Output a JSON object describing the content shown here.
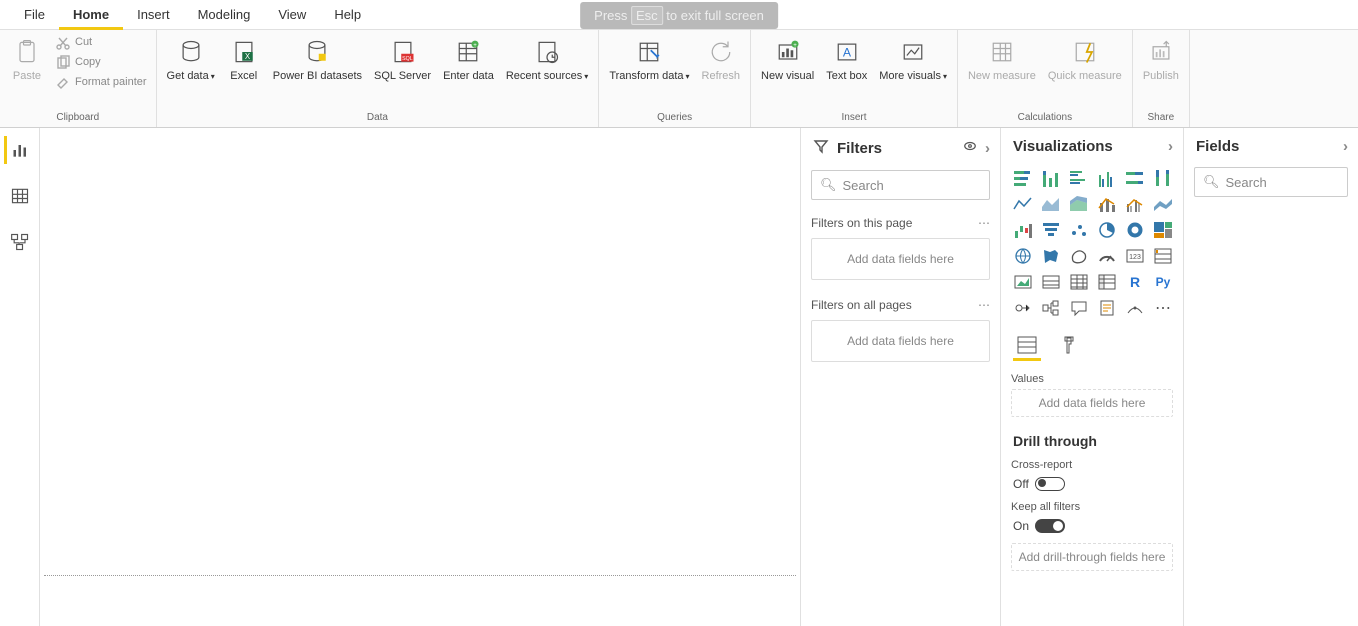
{
  "overlay": {
    "full_text": "Press Esc to exit full screen",
    "press": "Press",
    "esc": "Esc",
    "rest": "to exit full screen"
  },
  "tabs": {
    "file": "File",
    "home": "Home",
    "insert": "Insert",
    "modeling": "Modeling",
    "view": "View",
    "help": "Help"
  },
  "ribbon": {
    "clipboard": {
      "label": "Clipboard",
      "paste": "Paste",
      "cut": "Cut",
      "copy": "Copy",
      "format_painter": "Format painter"
    },
    "data": {
      "label": "Data",
      "get_data": "Get data",
      "excel": "Excel",
      "pbi_datasets": "Power BI datasets",
      "sql": "SQL Server",
      "enter": "Enter data",
      "recent": "Recent sources"
    },
    "queries": {
      "label": "Queries",
      "transform": "Transform data",
      "refresh": "Refresh"
    },
    "insert": {
      "label": "Insert",
      "new_visual": "New visual",
      "text_box": "Text box",
      "more_visuals": "More visuals"
    },
    "calc": {
      "label": "Calculations",
      "new_measure": "New measure",
      "quick_measure": "Quick measure"
    },
    "share": {
      "label": "Share",
      "publish": "Publish"
    }
  },
  "filters": {
    "title": "Filters",
    "search": "Search",
    "on_page": "Filters on this page",
    "on_all": "Filters on all pages",
    "add_here": "Add data fields here"
  },
  "viz": {
    "title": "Visualizations",
    "values": "Values",
    "add_here": "Add data fields here",
    "drill": "Drill through",
    "cross": "Cross-report",
    "off": "Off",
    "keep": "Keep all filters",
    "on": "On",
    "add_drill": "Add drill-through fields here",
    "r_label": "R",
    "py_label": "Py"
  },
  "fields": {
    "title": "Fields",
    "search": "Search"
  }
}
